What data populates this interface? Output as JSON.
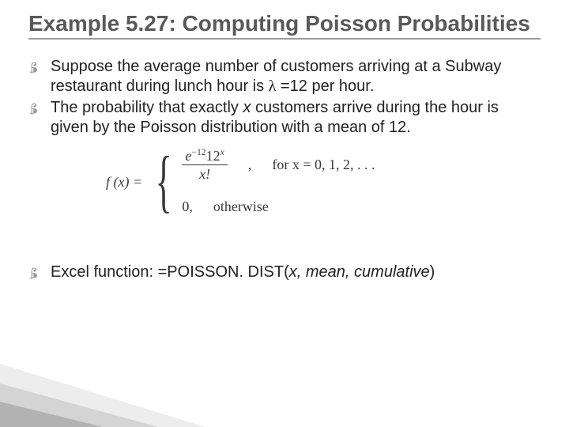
{
  "title": "Example 5.27: Computing Poisson Probabilities",
  "bullets1": {
    "item1_a": "Suppose the average number of customers arriving at a Subway restaurant during lunch hour is ",
    "item1_lambda": "λ",
    "item1_b": " =12 per hour.",
    "item2_a": "The probability that exactly ",
    "item2_x": "x",
    "item2_b": " customers arrive during the hour is given by the Poisson distribution with a mean of 12."
  },
  "formula": {
    "label": "f (x)  =",
    "num_a": "e",
    "num_exp": "−12",
    "num_b": "12",
    "num_bexp": "x",
    "den": "x!",
    "comma": ",",
    "cond1": "for x  =  0, 1, 2, . . .",
    "zero": "0,",
    "cond2": "otherwise"
  },
  "bullets2": {
    "item3_a": "Excel function: ",
    "item3_b": "=POISSON. DIST(",
    "item3_args": "x, mean, cumulative",
    "item3_c": ")"
  }
}
